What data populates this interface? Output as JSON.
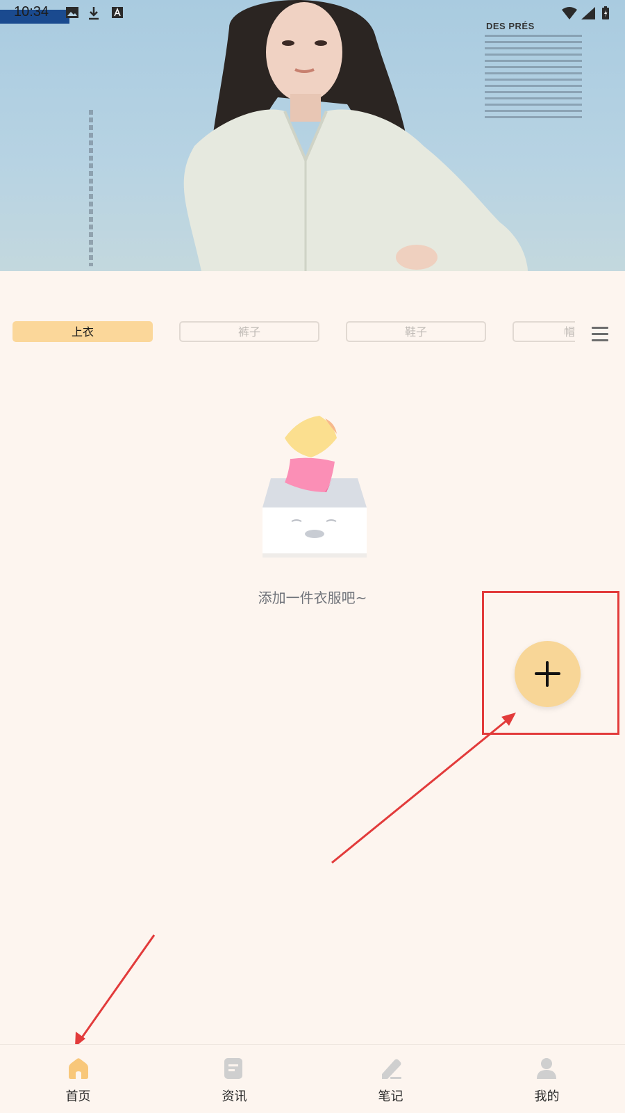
{
  "status_bar": {
    "time": "10:34"
  },
  "banner": {
    "magazine_title": "DES PRÉS"
  },
  "categories": {
    "tabs": [
      {
        "label": "上衣",
        "active": true
      },
      {
        "label": "裤子",
        "active": false
      },
      {
        "label": "鞋子",
        "active": false
      },
      {
        "label": "帽",
        "active": false
      }
    ]
  },
  "empty_state": {
    "message": "添加一件衣服吧~"
  },
  "fab": {
    "icon": "plus-icon"
  },
  "bottom_nav": {
    "items": [
      {
        "label": "首页",
        "icon": "home-icon",
        "active": true
      },
      {
        "label": "资讯",
        "icon": "news-icon",
        "active": false
      },
      {
        "label": "笔记",
        "icon": "note-pen-icon",
        "active": false
      },
      {
        "label": "我的",
        "icon": "profile-icon",
        "active": false
      }
    ]
  },
  "colors": {
    "background": "#fdf5ef",
    "accent": "#fbd79a",
    "annotation": "#e23b3b",
    "nav_active": "#f8c77a",
    "nav_inactive": "#cfcfcf"
  }
}
